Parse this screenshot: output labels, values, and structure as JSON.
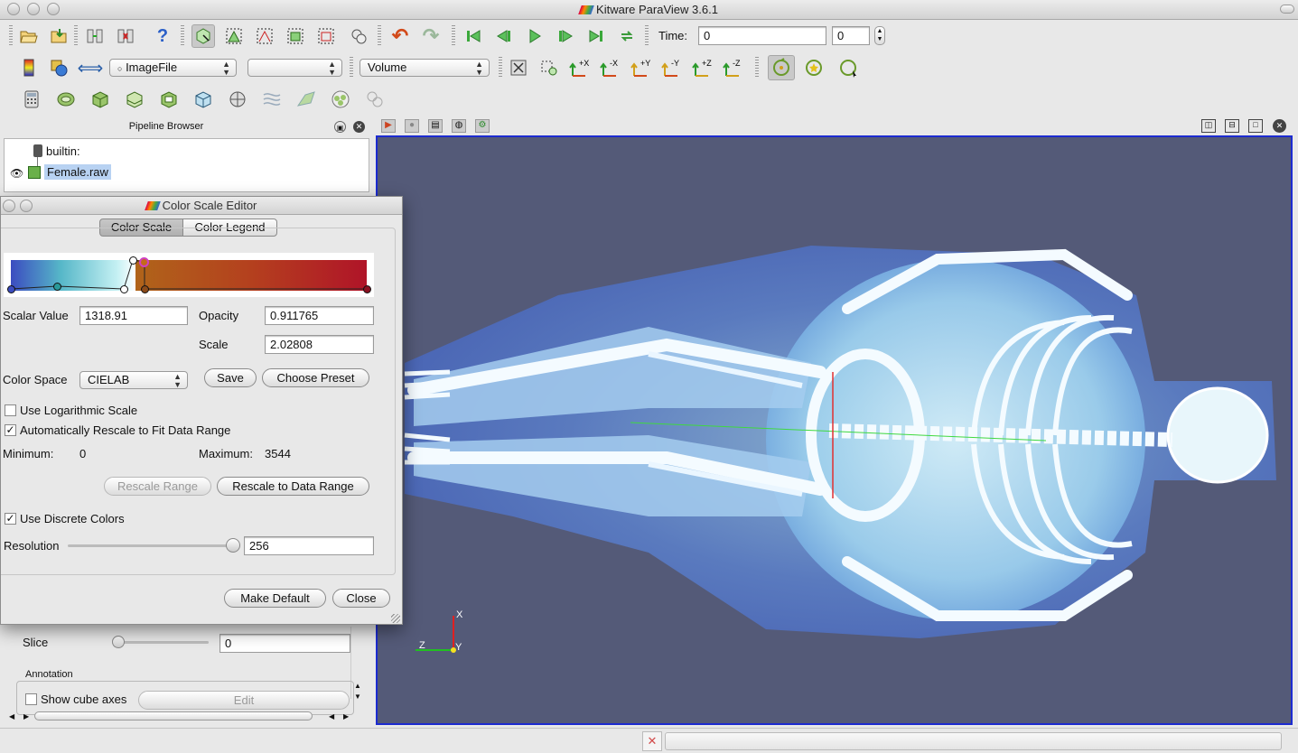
{
  "window": {
    "title": "Kitware ParaView 3.6.1"
  },
  "toolbar": {
    "time_label": "Time:",
    "time_value": "0",
    "time_index": "0",
    "source_combo": "ImageFile",
    "array_combo": "",
    "representation_combo": "Volume",
    "camera_buttons": [
      "+X",
      "-X",
      "+Y",
      "-Y",
      "+Z",
      "-Z"
    ]
  },
  "pipeline_browser": {
    "title": "Pipeline Browser",
    "items": [
      {
        "label": "builtin:"
      },
      {
        "label": "Female.raw"
      }
    ]
  },
  "properties_panel": {
    "slice_label": "Slice",
    "slice_value": "0",
    "annotation_heading": "Annotation",
    "show_cube_axes_label": "Show cube axes",
    "edit_button": "Edit"
  },
  "color_scale_editor": {
    "title": "Color Scale Editor",
    "tabs": [
      "Color Scale",
      "Color Legend"
    ],
    "scalar_value_label": "Scalar Value",
    "scalar_value": "1318.91",
    "opacity_label": "Opacity",
    "opacity_value": "0.911765",
    "scale_label": "Scale",
    "scale_value": "2.02808",
    "color_space_label": "Color Space",
    "color_space_value": "CIELAB",
    "save_button": "Save",
    "choose_preset_button": "Choose Preset",
    "use_log_scale_label": "Use Logarithmic Scale",
    "use_log_scale_checked": false,
    "auto_rescale_label": "Automatically Rescale to Fit Data Range",
    "auto_rescale_checked": true,
    "minimum_label": "Minimum:",
    "minimum_value": "0",
    "maximum_label": "Maximum:",
    "maximum_value": "3544",
    "rescale_range_button": "Rescale Range",
    "rescale_to_data_button": "Rescale to Data Range",
    "discrete_colors_label": "Use Discrete Colors",
    "discrete_colors_checked": true,
    "resolution_label": "Resolution",
    "resolution_value": "256",
    "make_default_button": "Make Default",
    "close_button": "Close"
  },
  "orientation_axes": {
    "x": "X",
    "y": "Y",
    "z": "Z"
  },
  "colors": {
    "view_background": "#545a78",
    "active_view_border": "#1c2bd0",
    "selection_highlight": "#b8d2f2"
  }
}
